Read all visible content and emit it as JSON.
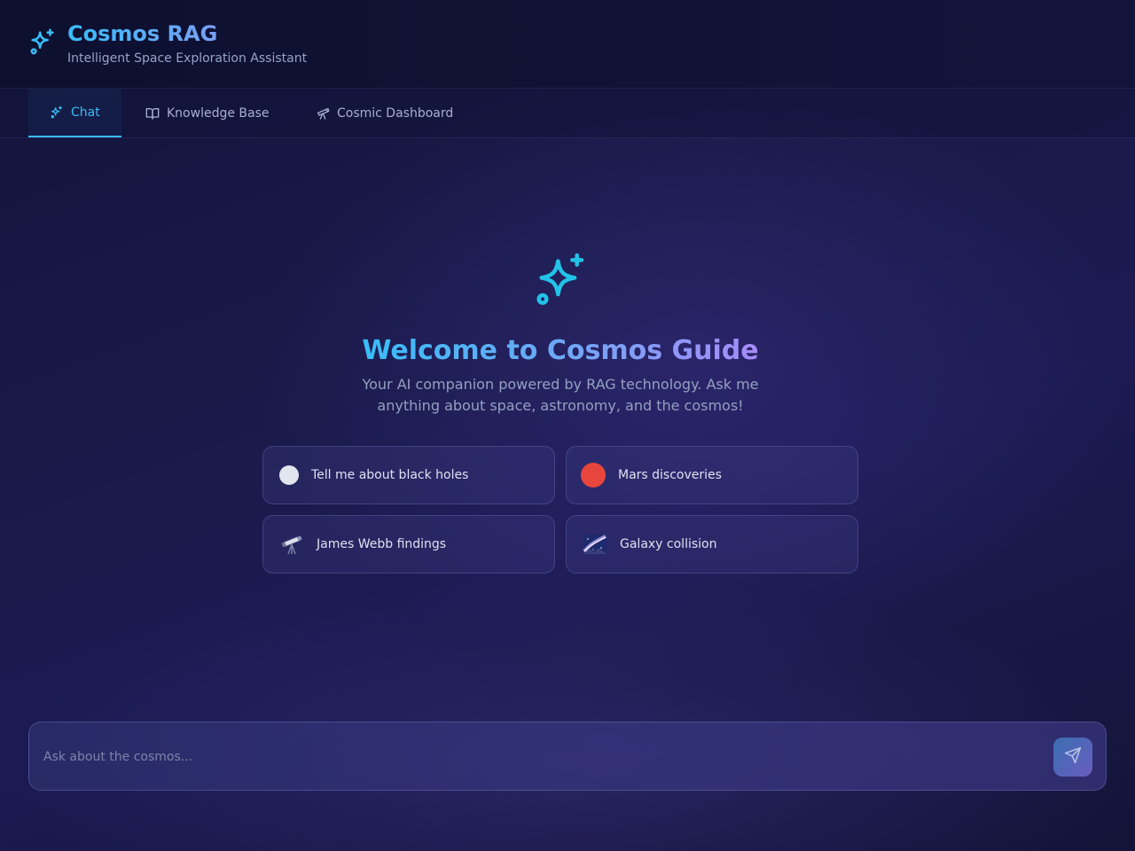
{
  "header": {
    "title": "Cosmos RAG",
    "subtitle": "Intelligent Space Exploration Assistant",
    "logo_icon": "sparkles-icon"
  },
  "tabs": [
    {
      "label": "Chat",
      "icon": "sparkles-icon",
      "active": true
    },
    {
      "label": "Knowledge Base",
      "icon": "book-open-icon",
      "active": false
    },
    {
      "label": "Cosmic Dashboard",
      "icon": "telescope-icon",
      "active": false
    }
  ],
  "welcome": {
    "icon": "sparkles-icon",
    "title": "Welcome to Cosmos Guide",
    "text": "Your AI companion powered by RAG technology. Ask me anything about space, astronomy, and the cosmos!"
  },
  "suggestions": [
    {
      "label": "Tell me about black holes",
      "icon": "white-circle-icon"
    },
    {
      "label": "Mars discoveries",
      "icon": "red-circle-icon"
    },
    {
      "label": "James Webb findings",
      "icon": "telescope-emoji-icon"
    },
    {
      "label": "Galaxy collision",
      "icon": "milky-way-emoji-icon"
    }
  ],
  "composer": {
    "placeholder": "Ask about the cosmos...",
    "send_icon": "send-icon"
  },
  "colors": {
    "accent": "#38bdf8",
    "accent_purple": "#a78bfa",
    "background": "#1a1a4a"
  }
}
